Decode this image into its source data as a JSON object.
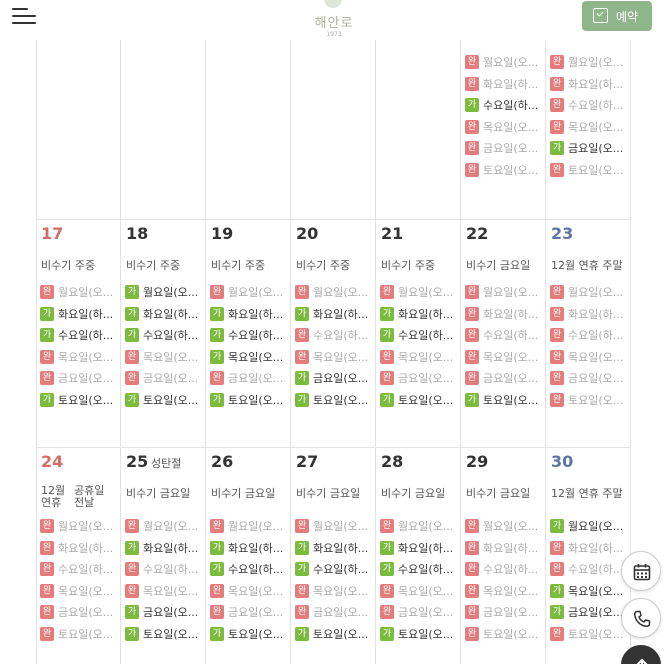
{
  "header": {
    "logo_name": "해안로",
    "logo_year": "1973",
    "reserve_label": "예약"
  },
  "badges": {
    "full": "완",
    "avail": "가"
  },
  "calendar": {
    "week1": [
      {
        "day": "",
        "rooms": []
      },
      {
        "day": "",
        "rooms": []
      },
      {
        "day": "",
        "rooms": []
      },
      {
        "day": "",
        "rooms": []
      },
      {
        "day": "",
        "rooms": []
      },
      {
        "day": "",
        "rooms": [
          {
            "status": "full",
            "name": "월요일(오..."
          },
          {
            "status": "full",
            "name": "화요일(하..."
          },
          {
            "status": "avail",
            "name": "수요일(하..."
          },
          {
            "status": "full",
            "name": "목요일(오..."
          },
          {
            "status": "full",
            "name": "금요일(오..."
          },
          {
            "status": "full",
            "name": "토요일(오..."
          }
        ]
      },
      {
        "day": "",
        "rooms": [
          {
            "status": "full",
            "name": "월요일(오..."
          },
          {
            "status": "full",
            "name": "화요일(하..."
          },
          {
            "status": "full",
            "name": "수요일(하..."
          },
          {
            "status": "full",
            "name": "목요일(오..."
          },
          {
            "status": "avail",
            "name": "금요일(오..."
          },
          {
            "status": "full",
            "name": "토요일(오..."
          }
        ]
      }
    ],
    "week2": [
      {
        "day": "17",
        "season": "비수기 주중",
        "rooms": [
          {
            "status": "full",
            "name": "월요일(오..."
          },
          {
            "status": "avail",
            "name": "화요일(하..."
          },
          {
            "status": "avail",
            "name": "수요일(하..."
          },
          {
            "status": "full",
            "name": "목요일(오..."
          },
          {
            "status": "full",
            "name": "금요일(오..."
          },
          {
            "status": "avail",
            "name": "토요일(오..."
          }
        ]
      },
      {
        "day": "18",
        "season": "비수기 주중",
        "rooms": [
          {
            "status": "avail",
            "name": "월요일(오..."
          },
          {
            "status": "avail",
            "name": "화요일(하..."
          },
          {
            "status": "avail",
            "name": "수요일(하..."
          },
          {
            "status": "full",
            "name": "목요일(오..."
          },
          {
            "status": "full",
            "name": "금요일(오..."
          },
          {
            "status": "avail",
            "name": "토요일(오..."
          }
        ]
      },
      {
        "day": "19",
        "season": "비수기 주중",
        "rooms": [
          {
            "status": "full",
            "name": "월요일(오..."
          },
          {
            "status": "avail",
            "name": "화요일(하..."
          },
          {
            "status": "avail",
            "name": "수요일(하..."
          },
          {
            "status": "avail",
            "name": "목요일(오..."
          },
          {
            "status": "full",
            "name": "금요일(오..."
          },
          {
            "status": "avail",
            "name": "토요일(오..."
          }
        ]
      },
      {
        "day": "20",
        "season": "비수기 주중",
        "rooms": [
          {
            "status": "full",
            "name": "월요일(오..."
          },
          {
            "status": "avail",
            "name": "화요일(하..."
          },
          {
            "status": "full",
            "name": "수요일(하..."
          },
          {
            "status": "full",
            "name": "목요일(오..."
          },
          {
            "status": "avail",
            "name": "금요일(오..."
          },
          {
            "status": "avail",
            "name": "토요일(오..."
          }
        ]
      },
      {
        "day": "21",
        "season": "비수기 주중",
        "rooms": [
          {
            "status": "full",
            "name": "월요일(오..."
          },
          {
            "status": "avail",
            "name": "화요일(하..."
          },
          {
            "status": "avail",
            "name": "수요일(하..."
          },
          {
            "status": "full",
            "name": "목요일(오..."
          },
          {
            "status": "full",
            "name": "금요일(오..."
          },
          {
            "status": "avail",
            "name": "토요일(오..."
          }
        ]
      },
      {
        "day": "22",
        "season": "비수기 금요일",
        "rooms": [
          {
            "status": "full",
            "name": "월요일(오..."
          },
          {
            "status": "full",
            "name": "화요일(하..."
          },
          {
            "status": "full",
            "name": "수요일(하..."
          },
          {
            "status": "full",
            "name": "목요일(오..."
          },
          {
            "status": "full",
            "name": "금요일(오..."
          },
          {
            "status": "avail",
            "name": "토요일(오..."
          }
        ]
      },
      {
        "day": "23",
        "season": "12월 연휴 주말",
        "rooms": [
          {
            "status": "full",
            "name": "월요일(오..."
          },
          {
            "status": "full",
            "name": "화요일(하..."
          },
          {
            "status": "full",
            "name": "수요일(하..."
          },
          {
            "status": "full",
            "name": "목요일(오..."
          },
          {
            "status": "full",
            "name": "금요일(오..."
          },
          {
            "status": "full",
            "name": "토요일(오..."
          }
        ]
      }
    ],
    "week3": [
      {
        "day": "24",
        "season_a": "12월 연휴",
        "season_b": "공휴일 전날",
        "rooms": [
          {
            "status": "full",
            "name": "월요일(오..."
          },
          {
            "status": "full",
            "name": "화요일(하..."
          },
          {
            "status": "full",
            "name": "수요일(하..."
          },
          {
            "status": "full",
            "name": "목요일(오..."
          },
          {
            "status": "full",
            "name": "금요일(오..."
          },
          {
            "status": "full",
            "name": "토요일(오..."
          }
        ]
      },
      {
        "day": "25",
        "holiday": "성탄절",
        "season": "비수기 금요일",
        "rooms": [
          {
            "status": "full",
            "name": "월요일(오..."
          },
          {
            "status": "avail",
            "name": "화요일(하..."
          },
          {
            "status": "full",
            "name": "수요일(하..."
          },
          {
            "status": "full",
            "name": "목요일(오..."
          },
          {
            "status": "avail",
            "name": "금요일(오..."
          },
          {
            "status": "avail",
            "name": "토요일(오..."
          }
        ]
      },
      {
        "day": "26",
        "season": "비수기 금요일",
        "rooms": [
          {
            "status": "full",
            "name": "월요일(오..."
          },
          {
            "status": "avail",
            "name": "화요일(하..."
          },
          {
            "status": "avail",
            "name": "수요일(하..."
          },
          {
            "status": "full",
            "name": "목요일(오..."
          },
          {
            "status": "full",
            "name": "금요일(오..."
          },
          {
            "status": "avail",
            "name": "토요일(오..."
          }
        ]
      },
      {
        "day": "27",
        "season": "비수기 금요일",
        "rooms": [
          {
            "status": "full",
            "name": "월요일(오..."
          },
          {
            "status": "avail",
            "name": "화요일(하..."
          },
          {
            "status": "avail",
            "name": "수요일(하..."
          },
          {
            "status": "full",
            "name": "목요일(오..."
          },
          {
            "status": "full",
            "name": "금요일(오..."
          },
          {
            "status": "avail",
            "name": "토요일(오..."
          }
        ]
      },
      {
        "day": "28",
        "season": "비수기 금요일",
        "rooms": [
          {
            "status": "full",
            "name": "월요일(오..."
          },
          {
            "status": "avail",
            "name": "화요일(하..."
          },
          {
            "status": "avail",
            "name": "수요일(하..."
          },
          {
            "status": "full",
            "name": "목요일(오..."
          },
          {
            "status": "full",
            "name": "금요일(오..."
          },
          {
            "status": "avail",
            "name": "토요일(오..."
          }
        ]
      },
      {
        "day": "29",
        "season": "비수기 금요일",
        "rooms": [
          {
            "status": "full",
            "name": "월요일(오..."
          },
          {
            "status": "full",
            "name": "화요일(하..."
          },
          {
            "status": "full",
            "name": "수요일(하..."
          },
          {
            "status": "full",
            "name": "목요일(오..."
          },
          {
            "status": "full",
            "name": "금요일(오..."
          },
          {
            "status": "full",
            "name": "토요일(오..."
          }
        ]
      },
      {
        "day": "30",
        "season": "12월 연휴 주말",
        "rooms": [
          {
            "status": "avail",
            "name": "월요일(오..."
          },
          {
            "status": "full",
            "name": "화요일(하..."
          },
          {
            "status": "full",
            "name": "수요일(하..."
          },
          {
            "status": "avail",
            "name": "목요일(오..."
          },
          {
            "status": "avail",
            "name": "금요일(오..."
          },
          {
            "status": "full",
            "name": "토요일(오..."
          }
        ]
      }
    ]
  },
  "colors": {
    "accent": "#8fb58a",
    "full_badge": "#e47c7c",
    "avail_badge": "#7dbb3f",
    "sunday": "#d96a6a",
    "saturday": "#5c74a8"
  },
  "fabs": {
    "calendar": "calendar-icon",
    "phone": "phone-icon",
    "top": "arrow-up-icon"
  }
}
